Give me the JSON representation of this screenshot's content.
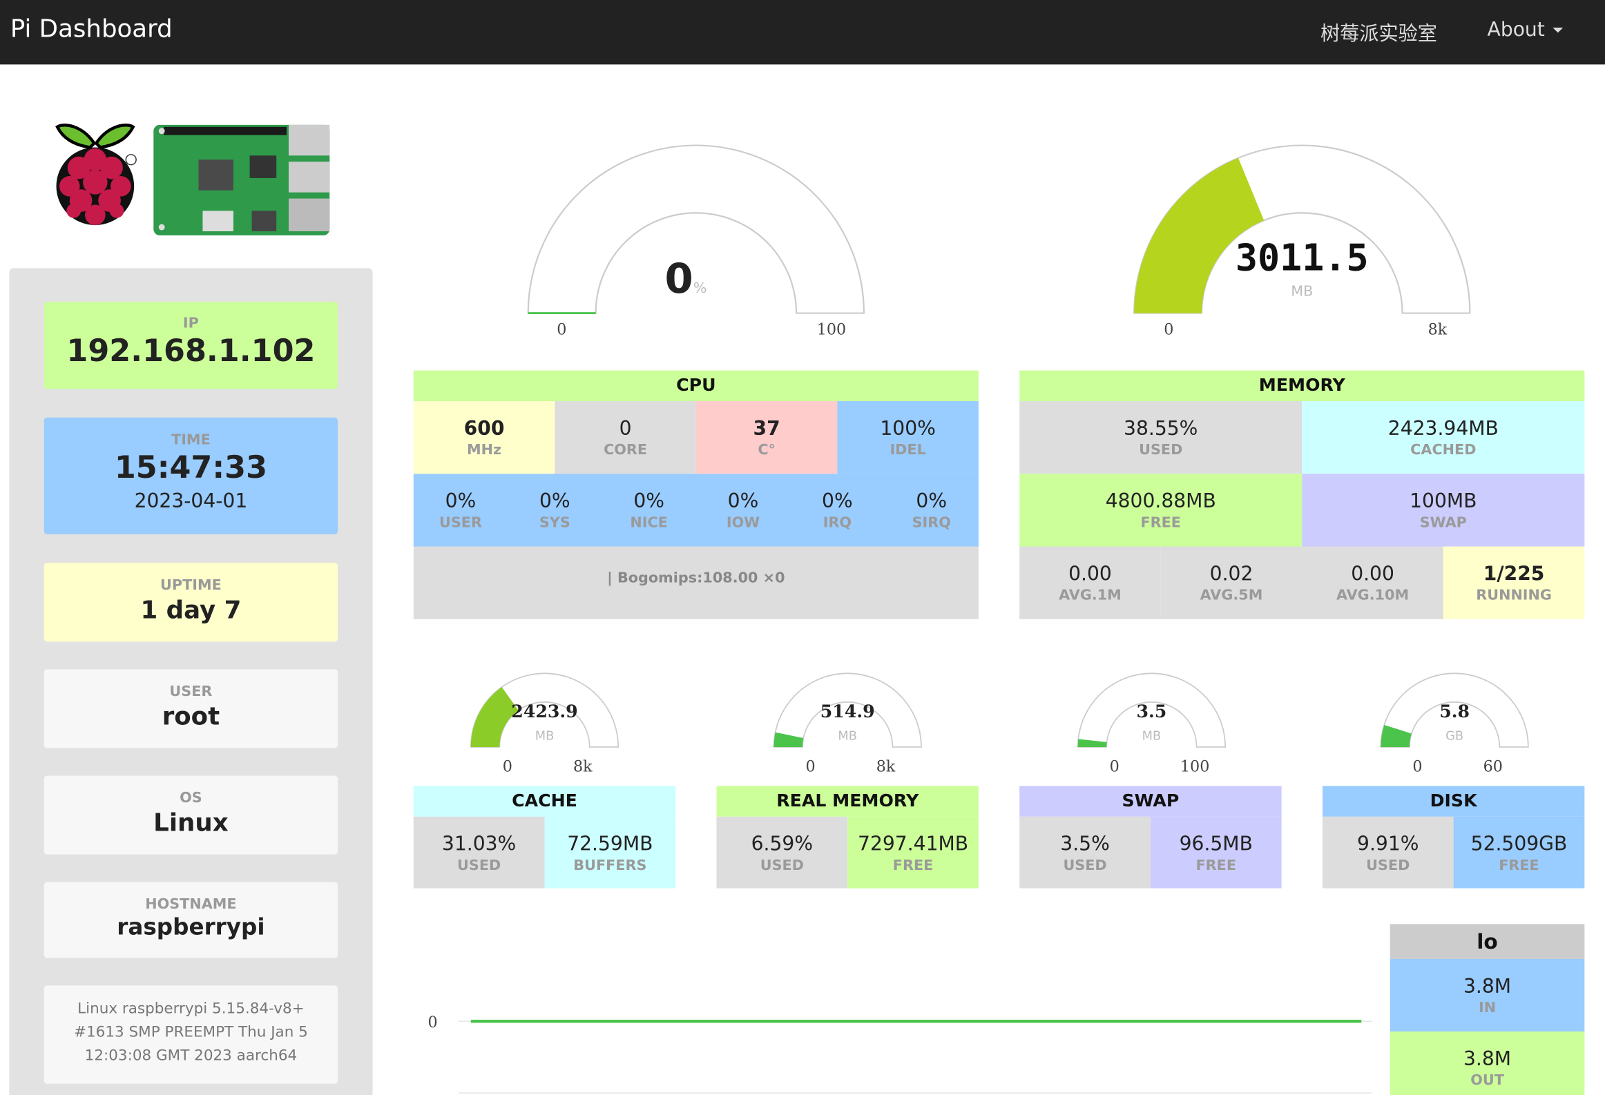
{
  "navbar": {
    "brand": "Pi Dashboard",
    "lab": "树莓派实验室",
    "about": "About"
  },
  "sidebar": {
    "ip": {
      "label": "IP",
      "value": "192.168.1.102"
    },
    "time": {
      "label": "TIME",
      "value": "15:47:33",
      "date": "2023-04-01"
    },
    "uptime": {
      "label": "UPTIME",
      "value": "1 day 7"
    },
    "user": {
      "label": "USER",
      "value": "root"
    },
    "os": {
      "label": "OS",
      "value": "Linux"
    },
    "hostname": {
      "label": "HOSTNAME",
      "value": "raspberrypi"
    },
    "kernel": "Linux raspberrypi 5.15.84-v8+ #1613 SMP PREEMPT Thu Jan 5 12:03:08 GMT 2023 aarch64"
  },
  "gauges": {
    "cpu": {
      "value": "0",
      "unit": "%",
      "min": "0",
      "max": "100",
      "fraction": 0.0
    },
    "memory": {
      "value": "3011.5",
      "unit": "MB",
      "min": "0",
      "max": "8k",
      "fraction": 0.376
    },
    "cache": {
      "value": "2423.9",
      "unit": "MB",
      "min": "0",
      "max": "8k",
      "fraction": 0.303
    },
    "real_memory": {
      "value": "514.9",
      "unit": "MB",
      "min": "0",
      "max": "8k",
      "fraction": 0.064
    },
    "swap": {
      "value": "3.5",
      "unit": "MB",
      "min": "0",
      "max": "100",
      "fraction": 0.035
    },
    "disk": {
      "value": "5.8",
      "unit": "GB",
      "min": "0",
      "max": "60",
      "fraction": 0.097
    }
  },
  "cpu": {
    "title": "CPU",
    "freq": {
      "value": "600",
      "label": "MHz"
    },
    "core": {
      "value": "0",
      "label": "CORE"
    },
    "temp": {
      "value": "37",
      "label": "C°"
    },
    "idle": {
      "value": "100%",
      "label": "IDEL"
    },
    "stats": [
      {
        "value": "0%",
        "label": "USER"
      },
      {
        "value": "0%",
        "label": "SYS"
      },
      {
        "value": "0%",
        "label": "NICE"
      },
      {
        "value": "0%",
        "label": "IOW"
      },
      {
        "value": "0%",
        "label": "IRQ"
      },
      {
        "value": "0%",
        "label": "SIRQ"
      }
    ],
    "bogomips": "| Bogomips:108.00 ×0"
  },
  "memory": {
    "title": "MEMORY",
    "used": {
      "value": "38.55%",
      "label": "USED"
    },
    "cached": {
      "value": "2423.94MB",
      "label": "CACHED"
    },
    "free": {
      "value": "4800.88MB",
      "label": "FREE"
    },
    "swap": {
      "value": "100MB",
      "label": "SWAP"
    },
    "load": [
      {
        "value": "0.00",
        "label": "AVG.1M"
      },
      {
        "value": "0.02",
        "label": "AVG.5M"
      },
      {
        "value": "0.00",
        "label": "AVG.10M"
      },
      {
        "value": "1/225",
        "label": "RUNNING"
      }
    ]
  },
  "panels": {
    "cache": {
      "title": "CACHE",
      "left": {
        "value": "31.03%",
        "label": "USED"
      },
      "right": {
        "value": "72.59MB",
        "label": "BUFFERS"
      }
    },
    "real_memory": {
      "title": "REAL MEMORY",
      "left": {
        "value": "6.59%",
        "label": "USED"
      },
      "right": {
        "value": "7297.41MB",
        "label": "FREE"
      }
    },
    "swap": {
      "title": "SWAP",
      "left": {
        "value": "3.5%",
        "label": "USED"
      },
      "right": {
        "value": "96.5MB",
        "label": "FREE"
      }
    },
    "disk": {
      "title": "DISK",
      "left": {
        "value": "9.91%",
        "label": "USED"
      },
      "right": {
        "value": "52.509GB",
        "label": "FREE"
      }
    }
  },
  "network": {
    "chart_y_tick": "0",
    "interface": "lo",
    "in": {
      "value": "3.8M",
      "label": "IN"
    },
    "out": {
      "value": "3.8M",
      "label": "OUT"
    }
  },
  "colors": {
    "gauge_fill": "#b4d41e",
    "gauge_fill_small": "#8ccc28",
    "cpu_gauge": "#4cc44c",
    "net_line": "#4cc44c"
  }
}
